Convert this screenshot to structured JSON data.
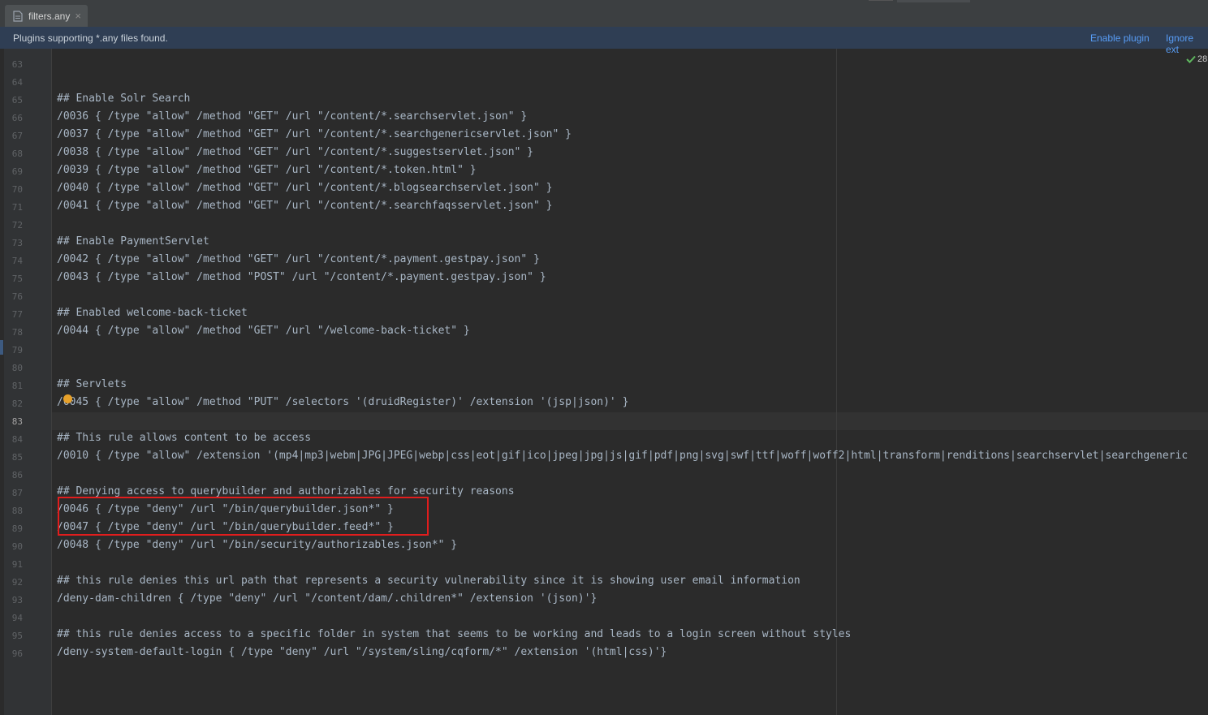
{
  "tab": {
    "title": "filters.any",
    "close": "×"
  },
  "banner": {
    "message": "Plugins supporting *.any files found.",
    "enable_plugin": "Enable plugin",
    "ignore_extension": "Ignore ext"
  },
  "inspection_count": "28",
  "colors": {
    "accent_link": "#589df6",
    "highlight_border": "#e11d1d",
    "background": "#2b2b2b"
  },
  "lines": [
    {
      "n": "63",
      "text": ""
    },
    {
      "n": "64",
      "text": ""
    },
    {
      "n": "65",
      "text": "## Enable Solr Search"
    },
    {
      "n": "66",
      "text": "/0036 { /type \"allow\" /method \"GET\" /url \"/content/*.searchservlet.json\" }"
    },
    {
      "n": "67",
      "text": "/0037 { /type \"allow\" /method \"GET\" /url \"/content/*.searchgenericservlet.json\" }"
    },
    {
      "n": "68",
      "text": "/0038 { /type \"allow\" /method \"GET\" /url \"/content/*.suggestservlet.json\" }"
    },
    {
      "n": "69",
      "text": "/0039 { /type \"allow\" /method \"GET\" /url \"/content/*.token.html\" }"
    },
    {
      "n": "70",
      "text": "/0040 { /type \"allow\" /method \"GET\" /url \"/content/*.blogsearchservlet.json\" }"
    },
    {
      "n": "71",
      "text": "/0041 { /type \"allow\" /method \"GET\" /url \"/content/*.searchfaqsservlet.json\" }"
    },
    {
      "n": "72",
      "text": ""
    },
    {
      "n": "73",
      "text": "## Enable PaymentServlet"
    },
    {
      "n": "74",
      "text": "/0042 { /type \"allow\" /method \"GET\" /url \"/content/*.payment.gestpay.json\" }"
    },
    {
      "n": "75",
      "text": "/0043 { /type \"allow\" /method \"POST\" /url \"/content/*.payment.gestpay.json\" }"
    },
    {
      "n": "76",
      "text": ""
    },
    {
      "n": "77",
      "text": "## Enabled welcome-back-ticket"
    },
    {
      "n": "78",
      "text": "/0044 { /type \"allow\" /method \"GET\" /url \"/welcome-back-ticket\" }"
    },
    {
      "n": "79",
      "text": ""
    },
    {
      "n": "80",
      "text": ""
    },
    {
      "n": "81",
      "text": "## Servlets"
    },
    {
      "n": "82",
      "text": "/0045 { /type \"allow\" /method \"PUT\" /selectors '(druidRegister)' /extension '(jsp|json)' }"
    },
    {
      "n": "83",
      "text": ""
    },
    {
      "n": "84",
      "text": "## This rule allows content to be access"
    },
    {
      "n": "85",
      "text": "/0010 { /type \"allow\" /extension '(mp4|mp3|webm|JPG|JPEG|webp|css|eot|gif|ico|jpeg|jpg|js|gif|pdf|png|svg|swf|ttf|woff|woff2|html|transform|renditions|searchservlet|searchgeneric"
    },
    {
      "n": "86",
      "text": ""
    },
    {
      "n": "87",
      "text": "## Denying access to querybuilder and authorizables for security reasons"
    },
    {
      "n": "88",
      "text": "/0046 { /type \"deny\" /url \"/bin/querybuilder.json*\" }"
    },
    {
      "n": "89",
      "text": "/0047 { /type \"deny\" /url \"/bin/querybuilder.feed*\" }"
    },
    {
      "n": "90",
      "text": "/0048 { /type \"deny\" /url \"/bin/security/authorizables.json*\" }"
    },
    {
      "n": "91",
      "text": ""
    },
    {
      "n": "92",
      "text": "## this rule denies this url path that represents a security vulnerability since it is showing user email information"
    },
    {
      "n": "93",
      "text": "/deny-dam-children { /type \"deny\" /url \"/content/dam/.children*\" /extension '(json)'}"
    },
    {
      "n": "94",
      "text": ""
    },
    {
      "n": "95",
      "text": "## this rule denies access to a specific folder in system that seems to be working and leads to a login screen without styles"
    },
    {
      "n": "96",
      "text": "/deny-system-default-login { /type \"deny\" /url \"/system/sling/cqform/*\" /extension '(html|css)'}"
    }
  ]
}
